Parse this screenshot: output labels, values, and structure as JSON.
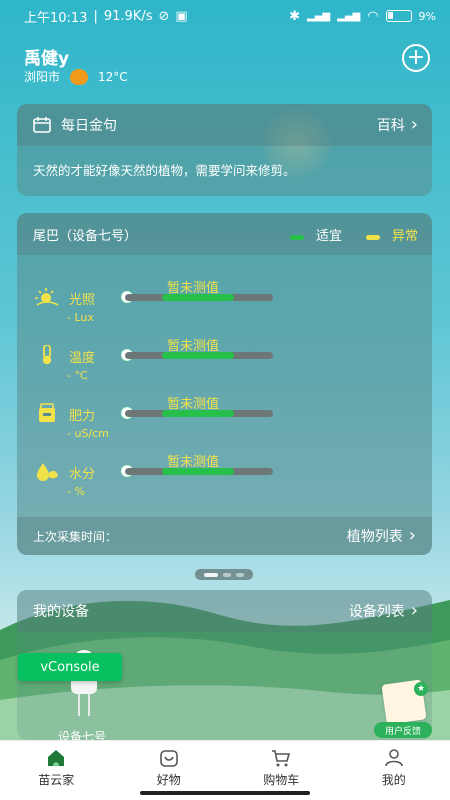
{
  "status_bar": {
    "time": "上午10:13",
    "speed": "91.9K/s",
    "signal_1": "5G",
    "signal_2": "5G",
    "battery": "9%"
  },
  "header": {
    "user_name": "禹健y",
    "city": "浏阳市",
    "temperature": "12°C",
    "weather_icon": "sunny-icon",
    "add_icon": "plus-circle-icon"
  },
  "daily_quote": {
    "title": "每日金句",
    "link_label": "百科",
    "text": "天然的才能好像天然的植物，需要学问来修剪。"
  },
  "device_card": {
    "title": "尾巴（设备七号）",
    "legend": [
      {
        "label": "适宜",
        "color": "#27c04a"
      },
      {
        "label": "异常",
        "color": "#f2e24a"
      }
    ],
    "metrics": [
      {
        "label": "光照",
        "unit": "- Lux",
        "status": "暂未测值",
        "icon": "sun-icon"
      },
      {
        "label": "温度",
        "unit": "- °C",
        "status": "暂未测值",
        "icon": "thermometer-icon"
      },
      {
        "label": "肥力",
        "unit": "- uS/cm",
        "status": "暂未测值",
        "icon": "fertilizer-icon"
      },
      {
        "label": "水分",
        "unit": "- %",
        "status": "暂未测值",
        "icon": "water-icon"
      }
    ],
    "last_collect_label": "上次采集时间：",
    "plant_list_label": "植物列表"
  },
  "my_devices": {
    "title": "我的设备",
    "link_label": "设备列表",
    "device_name": "设备七号"
  },
  "overlay": {
    "vconsole_label": "vConsole",
    "feedback_label": "用户反馈"
  },
  "bottom_nav": [
    {
      "label": "苗云家",
      "icon": "home-icon",
      "active": true
    },
    {
      "label": "好物",
      "icon": "smile-bag-icon",
      "active": false
    },
    {
      "label": "购物车",
      "icon": "cart-icon",
      "active": false
    },
    {
      "label": "我的",
      "icon": "user-icon",
      "active": false
    }
  ],
  "colors": {
    "accent_green": "#27c04a",
    "warning_yellow": "#f2e24a",
    "vconsole_green": "#07c160"
  }
}
